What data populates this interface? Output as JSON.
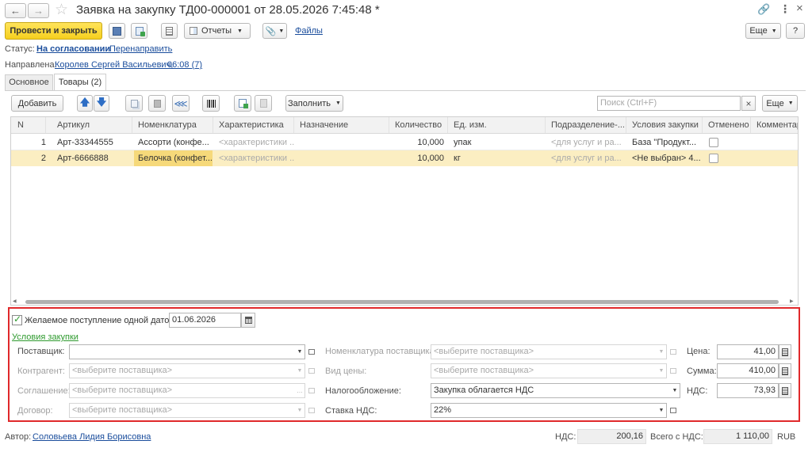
{
  "window": {
    "title": "Заявка на закупку ТД00-000001 от 28.05.2026 7:45:48 *"
  },
  "toolbar": {
    "post_close": "Провести и закрыть",
    "reports": "Отчеты",
    "files": "Файлы",
    "more": "Еще",
    "help": "?"
  },
  "status": {
    "label": "Статус:",
    "value": "На согласовании",
    "redirect": "Перенаправить"
  },
  "directed": {
    "label": "Направлена:",
    "person": "Королев Сергей Васильевич,",
    "time": "06:08 (7)"
  },
  "tabs": [
    {
      "label": "Основное"
    },
    {
      "label": "Товары (2)"
    }
  ],
  "items_toolbar": {
    "add": "Добавить",
    "fill": "Заполнить",
    "search_placeholder": "Поиск (Ctrl+F)",
    "clear": "×",
    "more": "Еще"
  },
  "table": {
    "columns": [
      "N",
      "Артикул",
      "Номенклатура",
      "Характеристика",
      "Назначение",
      "Количество",
      "Ед. изм.",
      "Подразделение-...",
      "Условия закупки",
      "Отменено",
      "Комментарий"
    ],
    "rows": [
      {
        "n": "1",
        "article": "Арт-33344555",
        "nomenclature": "Ассорти (конфе...",
        "characteristic": "<характеристики ...",
        "purpose": "",
        "quantity": "10,000",
        "unit": "упак",
        "department": "<для услуг и ра...",
        "terms": "База \"Продукт...",
        "cancelled": false,
        "comment": ""
      },
      {
        "n": "2",
        "article": "Арт-6666888",
        "nomenclature": "Белочка (конфет...",
        "characteristic": "<характеристики ...",
        "purpose": "",
        "quantity": "10,000",
        "unit": "кг",
        "department": "<для услуг и ра...",
        "terms": "<Не выбран> 4...",
        "cancelled": false,
        "comment": ""
      }
    ]
  },
  "details": {
    "desired_date_label": "Желаемое поступление одной датой",
    "desired_date_checked": true,
    "desired_date": "01.06.2026",
    "section_title": "Условия закупки",
    "supplier_label": "Поставщик:",
    "supplier_value": "",
    "counterparty_label": "Контрагент:",
    "counterparty_placeholder": "<выберите поставщика>",
    "agreement_label": "Соглашение:",
    "agreement_placeholder": "<выберите поставщика>",
    "contract_label": "Договор:",
    "contract_placeholder": "<выберите поставщика>",
    "supplier_nomenclature_label": "Номенклатура поставщика:",
    "supplier_nomenclature_placeholder": "<выберите поставщика>",
    "price_type_label": "Вид цены:",
    "price_type_placeholder": "<выберите поставщика>",
    "taxation_label": "Налогообложение:",
    "taxation_value": "Закупка облагается НДС",
    "vat_rate_label": "Ставка НДС:",
    "vat_rate_value": "22%",
    "price_label": "Цена:",
    "price_value": "41,00",
    "sum_label": "Сумма:",
    "sum_value": "410,00",
    "vat_label": "НДС:",
    "vat_value": "73,93"
  },
  "footer": {
    "author_label": "Автор:",
    "author": "Соловьева Лидия Борисовна",
    "vat_label": "НДС:",
    "vat_total": "200,16",
    "total_label": "Всего с НДС:",
    "total": "1 110,00",
    "currency": "RUB"
  },
  "colors": {
    "primary_button": "#ffd92e",
    "highlight_row": "#fbeec2",
    "highlight_cell": "#f6d97a",
    "link": "#1a4d9c",
    "red_frame": "#e0292b",
    "section_link": "#2e9a2e"
  }
}
